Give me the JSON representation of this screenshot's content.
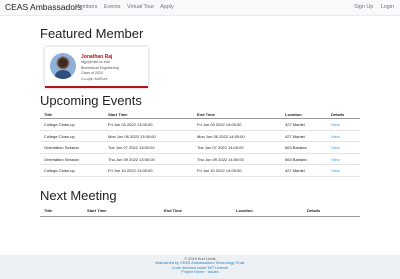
{
  "nav": {
    "brand": "CEAS Ambassadors",
    "links": [
      "Members",
      "Events",
      "Virtual Tour",
      "Apply"
    ],
    "right_links": [
      "Sign Up",
      "Login"
    ]
  },
  "featured": {
    "heading": "Featured Member",
    "name": "Jonathan Raj",
    "email": "rajjn@mail.uc.edu",
    "major": "Biomedical Engineering",
    "class_of": "Class of 2024",
    "co_op": "Co-ops: AtriCure",
    "accent": "#b5121b"
  },
  "upcoming": {
    "heading": "Upcoming Events",
    "columns": [
      "Title",
      "Start Time",
      "End Time",
      "Location",
      "Details"
    ],
    "rows": [
      [
        "College Close-up",
        "Fri Jun 03 2022 13:00:00",
        "Fri Jun 03 2022 14:00:00",
        "427 Mantei",
        "View"
      ],
      [
        "College Close-up",
        "Mon Jun 06 2022 13:00:00",
        "Mon Jun 06 2022 14:00:00",
        "427 Mantei",
        "View"
      ],
      [
        "Orientation Session",
        "Tue Jun 07 2022 13:00:00",
        "Tue Jun 07 2022 14:00:00",
        "663 Baldwin",
        "View"
      ],
      [
        "Orientation Session",
        "Thu Jun 09 2022 13:00:00",
        "Thu Jun 09 2022 14:00:00",
        "663 Baldwin",
        "View"
      ],
      [
        "College Close-up",
        "Fri Jun 10 2022 13:00:00",
        "Fri Jun 10 2022 14:00:00",
        "427 Mantei",
        "View"
      ]
    ]
  },
  "next_meeting": {
    "heading": "Next Meeting",
    "columns": [
      "Title",
      "Start Time",
      "End Time",
      "Location",
      "Details"
    ]
  },
  "footer": {
    "copyright": "© 2019 Kurt Lewis",
    "maintained": "Maintained by CEAS Ambassadors Technology Chair",
    "license": "Code licensed under MIT License",
    "project": "Project Home · Issues"
  },
  "colors": {
    "link": "#2a9fd6",
    "navbar_bg": "#f8f9fa"
  }
}
